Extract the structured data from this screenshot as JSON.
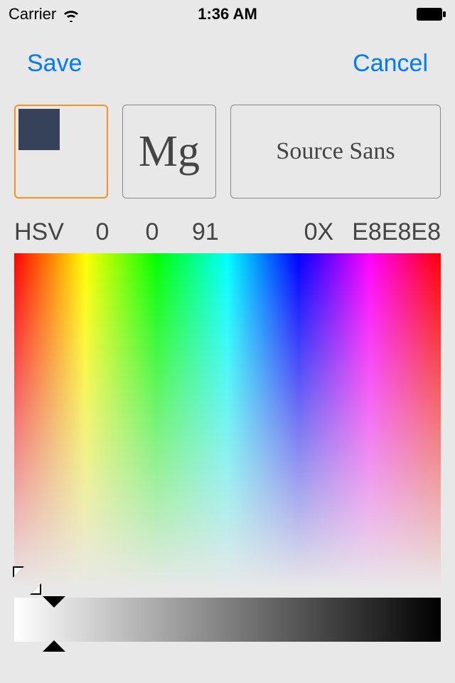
{
  "status": {
    "carrier": "Carrier",
    "time": "1:36 AM"
  },
  "nav": {
    "save": "Save",
    "cancel": "Cancel"
  },
  "swatch": {
    "selected_color": "#36415a"
  },
  "sample_glyph": "Mg",
  "font_name": "Source Sans",
  "hsv": {
    "label": "HSV",
    "h": "0",
    "s": "0",
    "v": "91"
  },
  "hex": {
    "label": "0X",
    "value": "E8E8E8"
  }
}
